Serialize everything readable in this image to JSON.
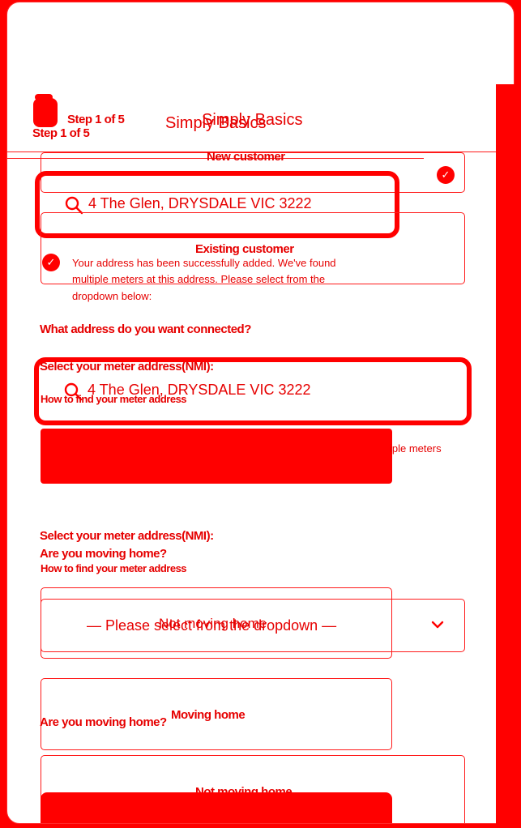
{
  "header": {
    "step_label": "Step 1 of 5",
    "step_label_ghost": "Step 1 of 5",
    "brand": "Simply Basics",
    "brand_ghost": "Simply Basics"
  },
  "customer_options": {
    "new_customer": "New customer",
    "existing_customer": "Existing customer"
  },
  "address_search": {
    "value": "4 The Glen, DRYSDALE  VIC  3222"
  },
  "success_message": {
    "line1": "Your address has been successfully added. We've found",
    "line2": "multiple meters at this address. Please select from the",
    "line3": "dropdown below:"
  },
  "connection": {
    "question": "What address do you want connected?",
    "meter_label": "Select your meter address(NMI):",
    "how_to_find": "How to find your meter address",
    "address_value": "4 The Glen, DRYSDALE  VIC  3222",
    "multiple_meters_fragment": "iple meters"
  },
  "meter_select": {
    "label": "Select your meter address(NMI):",
    "how_to_find": "How to find your meter address",
    "placeholder": "— Please select from the dropdown —",
    "ghost_text": "Not moving home"
  },
  "moving": {
    "question": "Are you moving home?",
    "question_ghost": "Are you moving home?",
    "moving_home": "Moving home",
    "not_moving_home": "Not moving home"
  },
  "colors": {
    "accent": "#ff0000",
    "text": "#e60000",
    "background": "#ffffff"
  }
}
